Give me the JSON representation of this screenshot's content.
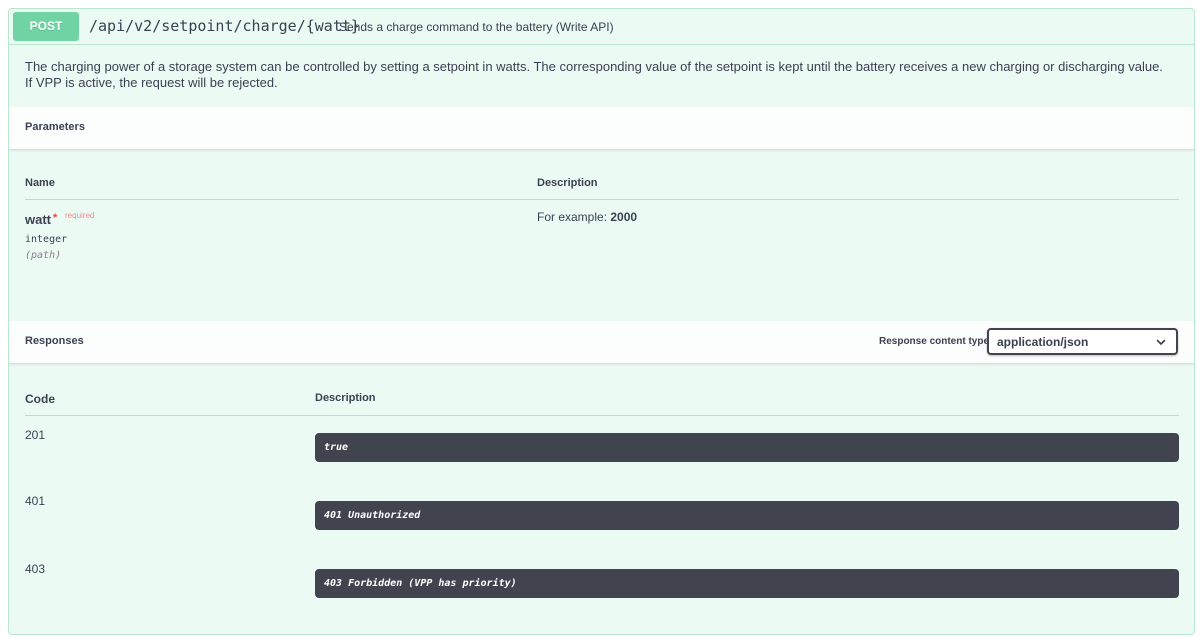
{
  "operation": {
    "method": "POST",
    "path": "/api/v2/setpoint/charge/{watt}",
    "summary": "Sends a charge command to the battery (Write API)",
    "description_line1": "The charging power of a storage system can be controlled by setting a setpoint in watts. The corresponding value of the setpoint is kept until the battery receives a new charging or discharging value.",
    "description_line2": "If VPP is active, the request will be rejected."
  },
  "parameters": {
    "title": "Parameters",
    "col_name": "Name",
    "col_description": "Description",
    "items": [
      {
        "name": "watt",
        "required_star": "*",
        "required_label": "required",
        "type": "integer",
        "in": "(path)",
        "example_prefix": "For example: ",
        "example_value": "2000"
      }
    ]
  },
  "responses": {
    "title": "Responses",
    "content_type_label": "Response content type",
    "content_type_value": "application/json",
    "col_code": "Code",
    "col_description": "Description",
    "items": [
      {
        "code": "201",
        "body": "true"
      },
      {
        "code": "401",
        "body": "401 Unauthorized"
      },
      {
        "code": "403",
        "body": "403 Forbidden (VPP has priority)"
      }
    ]
  },
  "colors": {
    "post_green": "#49cc90",
    "code_block_bg": "#41444e",
    "required_red": "#f93e3e"
  },
  "icons": {
    "select_chevron": "chevron-down-icon"
  }
}
